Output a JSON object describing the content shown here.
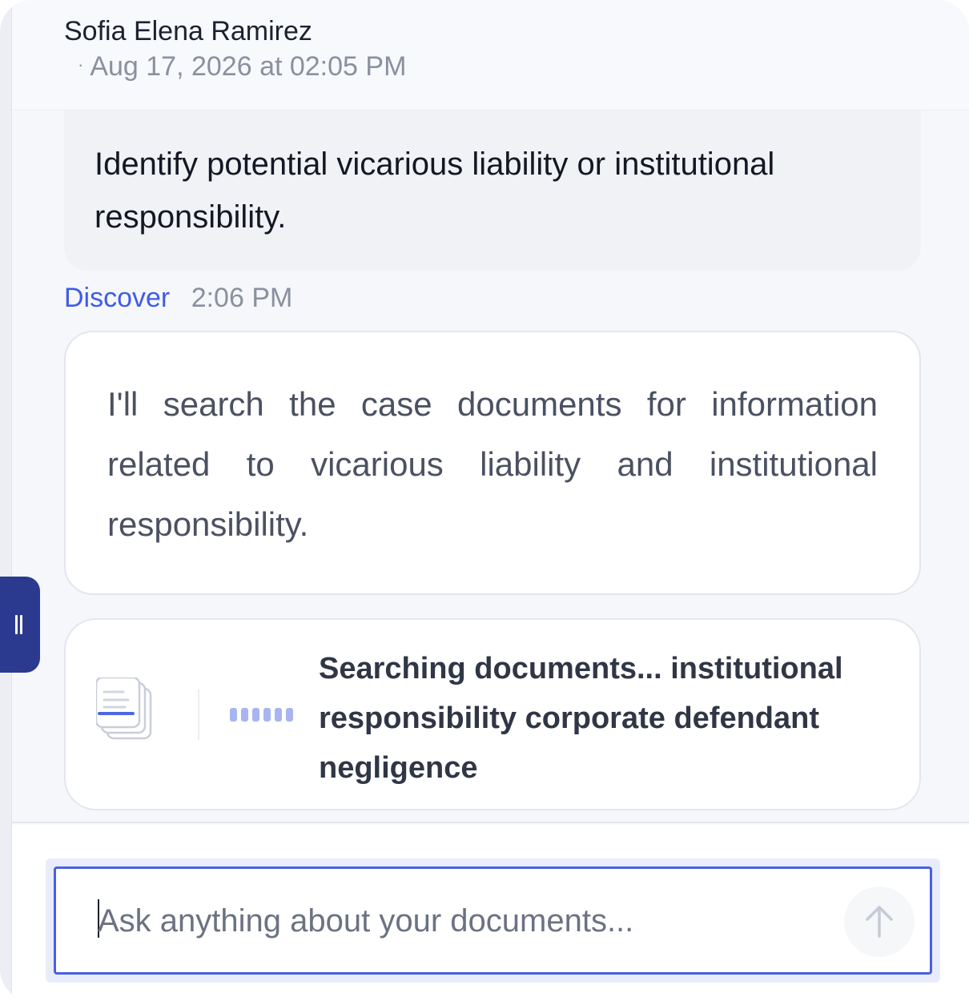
{
  "header": {
    "user_name": "Sofia Elena Ramirez",
    "separator": "·",
    "timestamp": "Aug 17, 2026 at 02:05 PM"
  },
  "user_message": {
    "text": "Identify potential vicarious liability or institutional responsibility."
  },
  "assistant": {
    "name": "Discover",
    "time": "2:06 PM",
    "message": "I'll search the case documents for information related to vicarious liability and institutional responsibility."
  },
  "search_status": {
    "text": "Searching documents... institutional responsibility corporate defendant negligence",
    "icon": "documents-icon"
  },
  "composer": {
    "placeholder": "Ask anything about your documents...",
    "value": ""
  },
  "colors": {
    "accent": "#3f5ce6",
    "handle": "#2b3a8f",
    "progress": "#a8b5f2"
  }
}
